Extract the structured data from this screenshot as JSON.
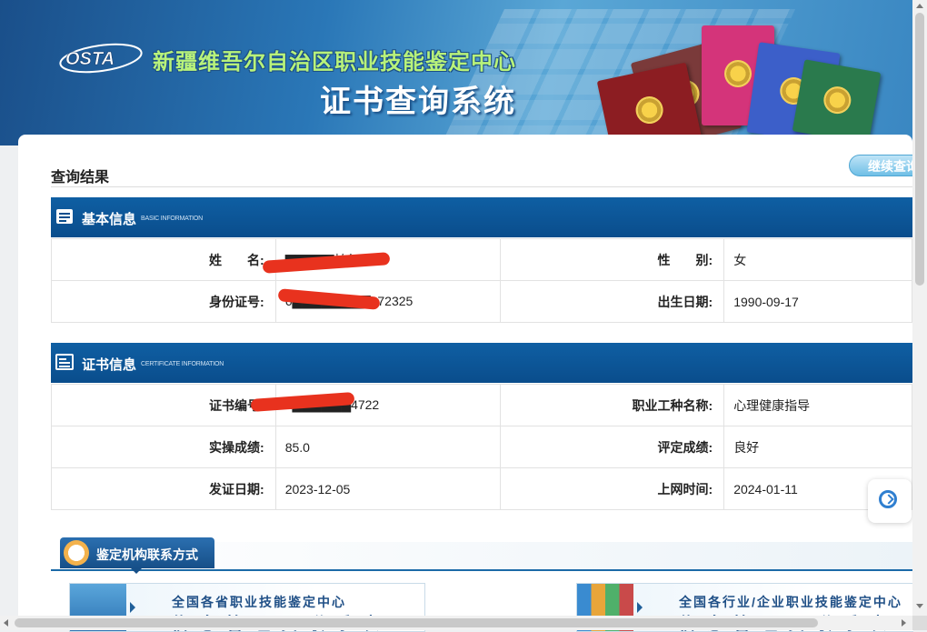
{
  "banner": {
    "logo_text": "OSTA",
    "org_title": "新疆维吾尔自治区职业技能鉴定中心",
    "system_title": "证书查询系统"
  },
  "result": {
    "title": "查询结果",
    "continue_button": "继续查询"
  },
  "basic_info": {
    "heading": "基本信息",
    "heading_en": "BASIC INFORMATION",
    "name_label": "姓　　名:",
    "name_value": "▇▇▇▇▇帕尔",
    "gender_label": "性　　别:",
    "gender_value": "女",
    "id_label": "身份证号:",
    "id_value": "6▇▇▇▇▇▇▇▇172325",
    "birth_label": "出生日期:",
    "birth_value": "1990-09-17"
  },
  "cert_info": {
    "heading": "证书信息",
    "heading_en": "CERTIFICATE INFORMATION",
    "cert_no_label": "证书编号:",
    "cert_no_value": "2▇▇▇▇▇▇4722",
    "occupation_label": "职业工种名称:",
    "occupation_value": "心理健康指导",
    "practical_label": "实操成绩:",
    "practical_value": "85.0",
    "rating_label": "评定成绩:",
    "rating_value": "良好",
    "issue_label": "发证日期:",
    "issue_value": "2023-12-05",
    "online_label": "上网时间:",
    "online_value": "2024-01-11"
  },
  "contact": {
    "heading": "鉴定机构联系方式",
    "card1_line1": "全国各省职业技能鉴定中心",
    "card1_line2": "信息管理员联系表",
    "card2_line1": "全国各行业/企业职业技能鉴定中心",
    "card2_line2": "信息管理员联系表"
  },
  "colors": {
    "header_blue": "#0a4d8c",
    "redaction_red": "#e8321e",
    "title_green": "#b8f27a"
  }
}
